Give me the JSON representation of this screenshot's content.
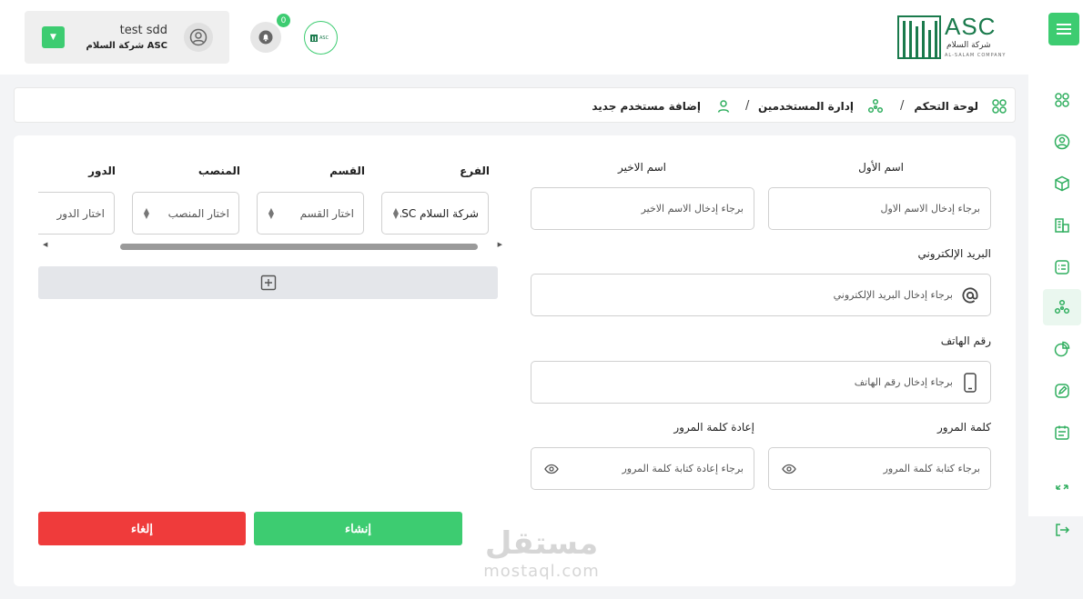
{
  "header": {
    "user_name": "test sdd",
    "user_company": "شركة السلام ASC",
    "notification_count": "0",
    "mini_logo_text": "ASC",
    "brand_name": "ASC",
    "brand_arabic": "شركة السلام",
    "brand_english": "AL-SALAM COMPANY"
  },
  "breadcrumb": {
    "home": "لوحة التحكم",
    "section": "إدارة المستخدمين",
    "current": "إضافة مستخدم جديد",
    "separator": "/"
  },
  "form": {
    "first_name_label": "اسم الأول",
    "first_name_placeholder": "برجاء إدخال الاسم الاول",
    "last_name_label": "اسم الاخير",
    "last_name_placeholder": "برجاء إدخال الاسم الاخير",
    "email_label": "البريد الإلكتروني",
    "email_placeholder": "برجاء إدخال البريد الإلكتروني",
    "phone_label": "رقم الهاتف",
    "phone_placeholder": "برجاء إدخال رقم الهاتف",
    "password_label": "كلمة المرور",
    "password_placeholder": "برجاء كتابة كلمة المرور",
    "confirm_label": "إعادة كلمة المرور",
    "confirm_placeholder": "برجاء إعادة كتابة كلمة المرور"
  },
  "assignments": {
    "branch_label": "الفرع",
    "branch_value": "شركة السلام ASC",
    "department_label": "القسم",
    "department_value": "اختار القسم",
    "position_label": "المنصب",
    "position_value": "اختار المنصب",
    "role_label": "الدور",
    "role_value": "اختار الدور"
  },
  "actions": {
    "create_label": "إنشاء",
    "cancel_label": "إلغاء"
  },
  "watermark": {
    "arabic": "مستقل",
    "english": "mostaql.com"
  },
  "colors": {
    "accent": "#3dcc71",
    "danger": "#ef3b3b",
    "brand": "#1a7a4c"
  },
  "sidebar_icons": [
    "menu-icon",
    "dashboard-icon",
    "user-settings-icon",
    "cube-icon",
    "buildings-icon",
    "checklist-icon",
    "users-network-icon",
    "pie-chart-icon",
    "edit-icon",
    "calendar-icon",
    "transfer-icon",
    "logout-icon"
  ]
}
